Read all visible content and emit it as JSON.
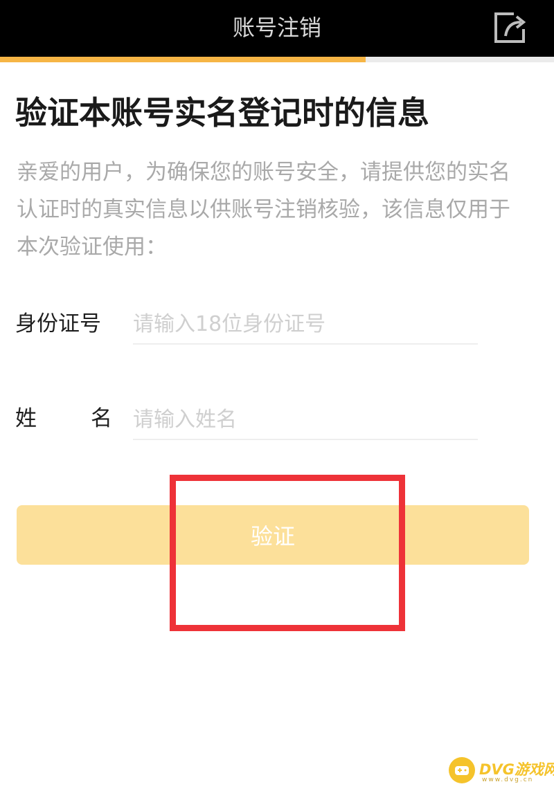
{
  "header": {
    "title": "账号注销",
    "share_icon": "share-icon",
    "progress_fraction": 0.66,
    "progress_color": "#f6b545"
  },
  "main": {
    "headline": "验证本账号实名登记时的信息",
    "description": "亲爱的用户，为确保您的账号安全，请提供您的实名认证时的真实信息以供账号注销核验，该信息仅用于本次验证使用："
  },
  "form": {
    "id_label": "身份证号",
    "id_placeholder": "请输入18位身份证号",
    "id_value": "",
    "name_label_first": "姓",
    "name_label_second": "名",
    "name_placeholder": "请输入姓名",
    "name_value": ""
  },
  "verify_button": {
    "label": "验证",
    "color": "#fce09a"
  },
  "annotation": {
    "highlight_color": "#ee3238"
  },
  "watermark": {
    "text": "DVG游戏网",
    "subtext": "www.dvg.cn",
    "logo_icon": "gamepad-icon"
  }
}
